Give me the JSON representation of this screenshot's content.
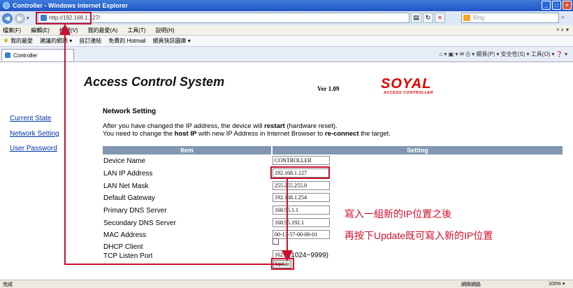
{
  "window": {
    "title": "Controller - Windows Internet Explorer",
    "controls": [
      "_",
      "□",
      "×"
    ]
  },
  "browser": {
    "url": "http://192.168.1.127/",
    "search_placeholder": "Bing",
    "menu": [
      "檔案(F)",
      "編輯(E)",
      "檢視(V)",
      "我的最愛(A)",
      "工具(T)",
      "說明(H)"
    ],
    "menu_right": "× ◐ ▾",
    "favorites_label": "我的最愛",
    "favorites_links": [
      "建議的網站 ▾",
      "自訂連結",
      "免費的 Hotmail",
      "網頁快訊圖庫 ▾"
    ],
    "tab_label": "Controller",
    "command_bar": "⌂ ▾ ▣ ▾ ✉ ⎙ ▾ 網頁(P) ▾ 安全性(S) ▾ 工具(O) ▾ ❓ ▾",
    "status_left": "完成",
    "status_zone": "網際網路",
    "status_zoom": "100% ▾"
  },
  "colors": {
    "accent_red": "#c8102e",
    "table_header": "#8296b2",
    "link": "#0033aa"
  },
  "header": {
    "title": "Access Control System",
    "version": "Ver 1.09",
    "logo": "SOYAL",
    "logo_sub": "ACCESS CONTROLLER"
  },
  "sidebar": {
    "items": [
      {
        "label": "Current State"
      },
      {
        "label": "Network Setting"
      },
      {
        "label": "User Password"
      }
    ]
  },
  "section_title": "Network Setting",
  "notice": {
    "l1_pre": "After you have changed the IP address, the device will ",
    "l1_bold": "restart",
    "l1_post": " (hardware reset).",
    "l2_pre": "You need to change the ",
    "l2_bold": "host IP",
    "l2_mid": " with new IP Address in Internet Browser to ",
    "l2_bold2": "re-connect",
    "l2_post": " the target."
  },
  "table": {
    "col_item": "Item",
    "col_setting": "Setting",
    "rows": [
      {
        "label": "Device Name",
        "value": "CONTROLLER"
      },
      {
        "label": "LAN IP Address",
        "value": "192.168.1.127"
      },
      {
        "label": "LAN Net Mask",
        "value": "255.255.255.0"
      },
      {
        "label": "Default Gateway",
        "value": "192.168.1.254"
      },
      {
        "label": "Primary DNS Server",
        "value": "168.95.1.1"
      },
      {
        "label": "Secondary DNS Server",
        "value": "168.95.192.1"
      },
      {
        "label": "MAC Address",
        "value": "00-13-57-00-00-01"
      },
      {
        "label": "DHCP Client",
        "value": ""
      },
      {
        "label": "TCP Listen Port",
        "value": "1621"
      }
    ],
    "dhcp_checked": false,
    "port_hint": "(1024~9999)",
    "update_label": "Update"
  },
  "annotations": {
    "line1": "寫入一組新的IP位置之後",
    "line2": "再按下Update既可寫入新的IP位置"
  }
}
